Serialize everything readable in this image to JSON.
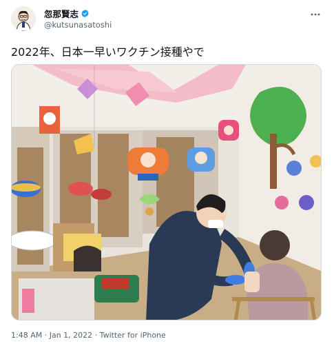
{
  "user": {
    "display_name": "忽那賢志",
    "handle": "@kutsunasatoshi",
    "verified": true
  },
  "tweet": {
    "text": "2022年、日本一早いワクチン接種やで",
    "time": "1:48 AM",
    "separator1": " · ",
    "date": "Jan 1, 2022",
    "separator2": " · ",
    "source": "Twitter for iPhone"
  },
  "icons": {
    "more": "more-icon",
    "verified": "verified-badge-icon"
  },
  "colors": {
    "verified_blue": "#1d9bf0",
    "secondary_text": "#536471"
  }
}
